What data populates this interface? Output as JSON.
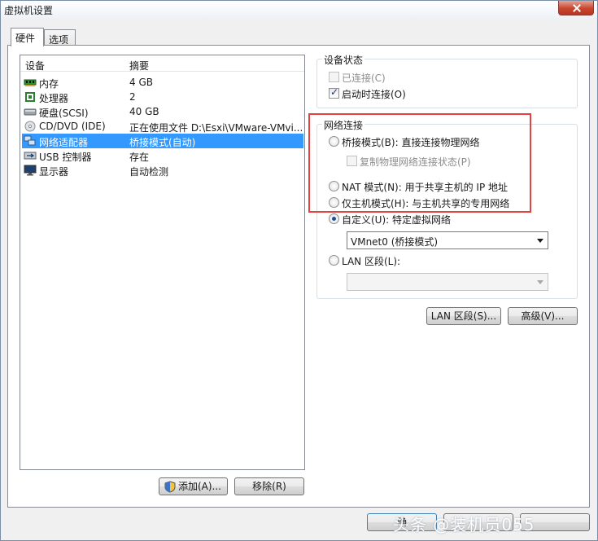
{
  "window": {
    "title": "虚拟机设置"
  },
  "tabs": [
    {
      "label": "硬件",
      "active": true
    },
    {
      "label": "选项",
      "active": false
    }
  ],
  "device_list": {
    "columns": [
      "设备",
      "摘要"
    ],
    "rows": [
      {
        "name": "内存",
        "summary": "4 GB",
        "icon": "memory-icon"
      },
      {
        "name": "处理器",
        "summary": "2",
        "icon": "processor-icon"
      },
      {
        "name": "硬盘(SCSI)",
        "summary": "40 GB",
        "icon": "hard-disk-icon"
      },
      {
        "name": "CD/DVD (IDE)",
        "summary": "正在使用文件 D:\\Esxi\\VMware-VMvi...",
        "icon": "cd-dvd-icon"
      },
      {
        "name": "网络适配器",
        "summary": "桥接模式(自动)",
        "icon": "network-adapter-icon",
        "selected": true
      },
      {
        "name": "USB 控制器",
        "summary": "存在",
        "icon": "usb-controller-icon"
      },
      {
        "name": "显示器",
        "summary": "自动检测",
        "icon": "display-icon"
      }
    ]
  },
  "buttons": {
    "add": "添加(A)...",
    "remove": "移除(R)",
    "lan_segments": "LAN 区段(S)...",
    "advanced": "高级(V)...",
    "ok": "确"
  },
  "device_status": {
    "title": "设备状态",
    "connected": {
      "label": "已连接(C)",
      "checked": false,
      "enabled": false
    },
    "connect_at_power_on": {
      "label": "启动时连接(O)",
      "checked": true,
      "enabled": true
    }
  },
  "network_connection": {
    "title": "网络连接",
    "bridged": {
      "label": "桥接模式(B): 直接连接物理网络",
      "selected": false
    },
    "replicate": {
      "label": "复制物理网络连接状态(P)",
      "checked": false,
      "enabled": false
    },
    "nat": {
      "label": "NAT 模式(N): 用于共享主机的 IP 地址",
      "selected": false
    },
    "host_only": {
      "label": "仅主机模式(H): 与主机共享的专用网络",
      "selected": false
    },
    "custom": {
      "label": "自定义(U): 特定虚拟网络",
      "selected": true,
      "value": "VMnet0 (桥接模式)"
    },
    "lan_segment": {
      "label": "LAN 区段(L):",
      "selected": false,
      "value": ""
    }
  },
  "watermark": "头条 @装机员055",
  "colors": {
    "highlight": "#e3433f",
    "selection": "#3399ff",
    "radio_dot": "#1f4f95"
  }
}
